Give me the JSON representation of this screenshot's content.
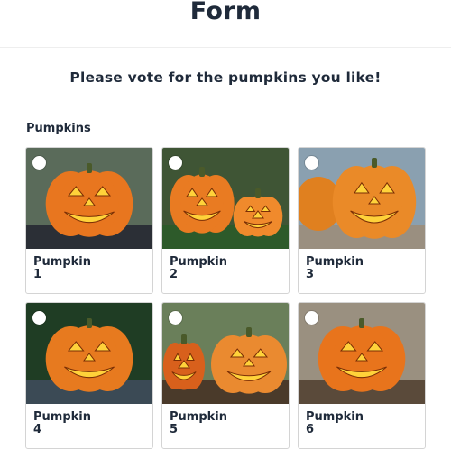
{
  "form": {
    "title": "Form",
    "question": "Please vote for the pumpkins you like!",
    "section_label": "Pumpkins"
  },
  "options": [
    {
      "label": "Pumpkin\n1",
      "bg": "#5a6b5a",
      "ground": "#2b2f36",
      "pumpkin": "#e8761f",
      "selected": false
    },
    {
      "label": "Pumpkin\n2",
      "bg": "#3f5535",
      "ground": "#2d5a2a",
      "pumpkin": "#e97b22",
      "selected": false
    },
    {
      "label": "Pumpkin\n3",
      "bg": "#8aa0b0",
      "ground": "#9a8f80",
      "pumpkin": "#ea8a28",
      "selected": false
    },
    {
      "label": "Pumpkin\n4",
      "bg": "#1f3d24",
      "ground": "#3b4a55",
      "pumpkin": "#e77a1f",
      "selected": false
    },
    {
      "label": "Pumpkin\n5",
      "bg": "#6a7f5a",
      "ground": "#4a3a2a",
      "pumpkin": "#ea8a30",
      "selected": false
    },
    {
      "label": "Pumpkin\n6",
      "bg": "#9a9080",
      "ground": "#5a4a3a",
      "pumpkin": "#e8741c",
      "selected": false
    }
  ]
}
